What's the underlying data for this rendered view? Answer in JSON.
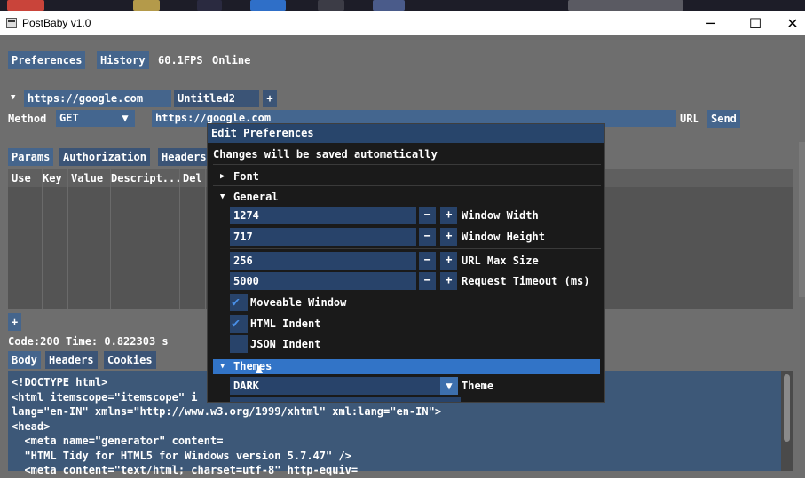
{
  "window": {
    "title": "PostBaby v1.0",
    "minimize_glyph": "─",
    "maximize_glyph": "☐",
    "close_glyph": "✕"
  },
  "toolbar": {
    "preferences": "Preferences",
    "history": "History",
    "fps": "60.1FPS",
    "status": "Online"
  },
  "tabs": {
    "collapse_glyph": "▼",
    "items": [
      "https://google.com",
      "Untitled2"
    ],
    "add": "+"
  },
  "request": {
    "method_label": "Method",
    "method_value": "GET",
    "url_value": "https://google.com",
    "url_label": "URL",
    "send": "Send"
  },
  "params_tabs": [
    "Params",
    "Authorization",
    "Headers"
  ],
  "params_table": {
    "columns": [
      "Use",
      "Key",
      "Value",
      "Descript...",
      "Del"
    ],
    "add": "+"
  },
  "response": {
    "status_line": "Code:200 Time: 0.822303 s",
    "tabs": [
      "Body",
      "Headers",
      "Cookies"
    ],
    "body_lines": [
      "<!DOCTYPE html>",
      "<html itemscope=\"itemscope\" i",
      "lang=\"en-IN\" xmlns=\"http://www.w3.org/1999/xhtml\" xml:lang=\"en-IN\">",
      "<head>",
      "  <meta name=\"generator\" content=",
      "  \"HTML Tidy for HTML5 for Windows version 5.7.47\" />",
      "  <meta content=\"text/html; charset=utf-8\" http-equiv="
    ]
  },
  "modal": {
    "title": "Edit Preferences",
    "note": "Changes will be saved automatically",
    "font_header": "Font",
    "general_header": "General",
    "fields": [
      {
        "value": "1274",
        "label": "Window Width"
      },
      {
        "value": "717",
        "label": "Window Height"
      },
      {
        "value": "256",
        "label": "URL Max Size"
      },
      {
        "value": "5000",
        "label": "Request Timeout (ms)"
      }
    ],
    "minus": "−",
    "plus": "+",
    "checkboxes": [
      {
        "label": "Moveable Window",
        "checked": true
      },
      {
        "label": "HTML Indent",
        "checked": true
      },
      {
        "label": "JSON Indent",
        "checked": false
      }
    ],
    "themes_header": "Themes",
    "theme_value": "DARK",
    "theme_label": "Theme",
    "expanded_glyph": "▼",
    "collapsed_glyph": "▶",
    "check_glyph": "✔"
  },
  "colors": {
    "accent": "#45658c",
    "modal_bg": "#1a1a1a",
    "selected": "#3274c7",
    "fps": "#e8e84a",
    "online": "#4fe04f"
  }
}
